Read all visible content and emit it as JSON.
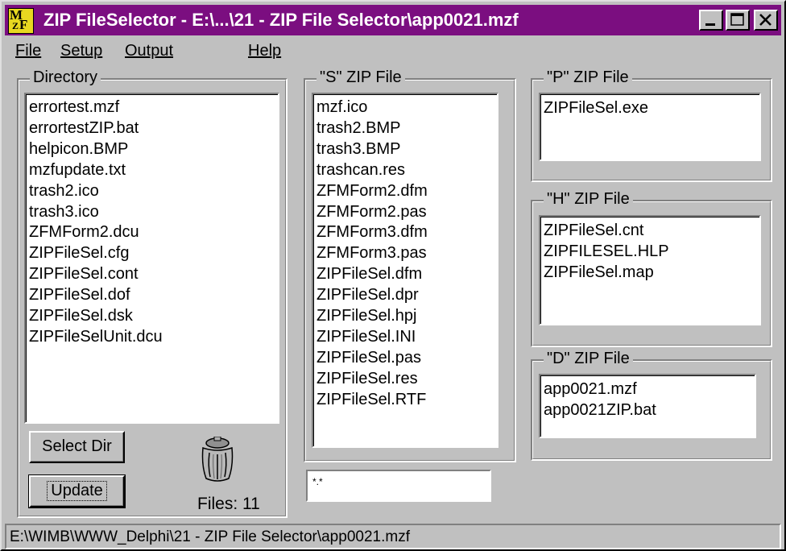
{
  "window": {
    "title": "ZIP FileSelector - E:\\...\\21 - ZIP File Selector\\app0021.mzf",
    "icon_text": [
      "M",
      "F",
      "Z"
    ],
    "controls": {
      "minimize": "_",
      "maximize": "□",
      "close": "✕"
    },
    "titlebar_color": "#7b0e80"
  },
  "menu": {
    "file": "File",
    "setup": "Setup",
    "output": "Output",
    "help": "Help"
  },
  "directory": {
    "label": "Directory",
    "items": [
      "errortest.mzf",
      "errortestZIP.bat",
      "helpicon.BMP",
      "mzfupdate.txt",
      "trash2.ico",
      "trash3.ico",
      "ZFMForm2.dcu",
      "ZIPFileSel.cfg",
      "ZIPFileSel.cont",
      "ZIPFileSel.dof",
      "ZIPFileSel.dsk",
      "ZIPFileSelUnit.dcu"
    ],
    "select_dir_button": "Select Dir",
    "update_button": "Update",
    "files_count": "Files: 11",
    "trash_icon": "trash-can-icon"
  },
  "s_zip": {
    "label": "\"S\" ZIP File",
    "items": [
      "mzf.ico",
      "trash2.BMP",
      "trash3.BMP",
      "trashcan.res",
      "ZFMForm2.dfm",
      "ZFMForm2.pas",
      "ZFMForm3.dfm",
      "ZFMForm3.pas",
      "ZIPFileSel.dfm",
      "ZIPFileSel.dpr",
      "ZIPFileSel.hpj",
      "ZIPFileSel.INI",
      "ZIPFileSel.pas",
      "ZIPFileSel.res",
      "ZIPFileSel.RTF"
    ],
    "mask_value": "*.*"
  },
  "p_zip": {
    "label": "\"P\" ZIP File",
    "items": [
      "ZIPFileSel.exe"
    ]
  },
  "h_zip": {
    "label": "\"H\" ZIP File",
    "items": [
      "ZIPFileSel.cnt",
      "ZIPFILESEL.HLP",
      "ZIPFileSel.map"
    ]
  },
  "d_zip": {
    "label": "\"D\" ZIP File",
    "items": [
      "app0021.mzf",
      "app0021ZIP.bat"
    ]
  },
  "status": {
    "path": "E:\\WIMB\\WWW_Delphi\\21 - ZIP File Selector\\app0021.mzf"
  }
}
